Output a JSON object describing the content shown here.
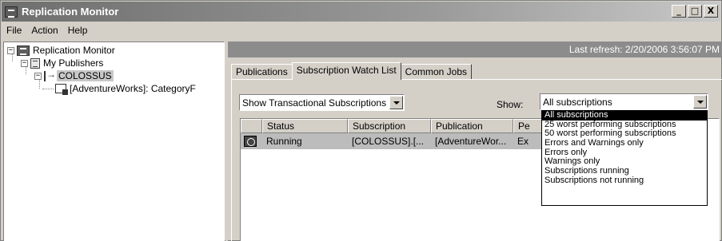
{
  "window": {
    "title": "Replication Monitor",
    "controls": [
      "_",
      "□",
      "X"
    ]
  },
  "menu": {
    "file": "File",
    "action": "Action",
    "help": "Help"
  },
  "tree": {
    "root": "Replication Monitor",
    "publishers": "My Publishers",
    "server": "COLOSSUS",
    "publication": "[AdventureWorks]: CategoryF"
  },
  "refresh": "Last refresh: 2/20/2006 3:56:07 PM",
  "tabs": [
    "Publications",
    "Subscription Watch List",
    "Common Jobs"
  ],
  "filter": {
    "type_value": "Show Transactional Subscriptions",
    "show_label": "Show:",
    "show_value": "All subscriptions"
  },
  "grid": {
    "headers": [
      "",
      "Status",
      "Subscription",
      "Publication",
      "Pe"
    ],
    "rows": [
      {
        "status": "Running",
        "subscription": "[COLOSSUS].[...",
        "publication": "[AdventureWor...",
        "extra": "Ex"
      }
    ]
  },
  "show_options": [
    "All subscriptions",
    "25 worst performing subscriptions",
    "50 worst performing subscriptions",
    "Errors and Warnings only",
    "Errors only",
    "Warnings only",
    "Subscriptions running",
    "Subscriptions not running"
  ]
}
